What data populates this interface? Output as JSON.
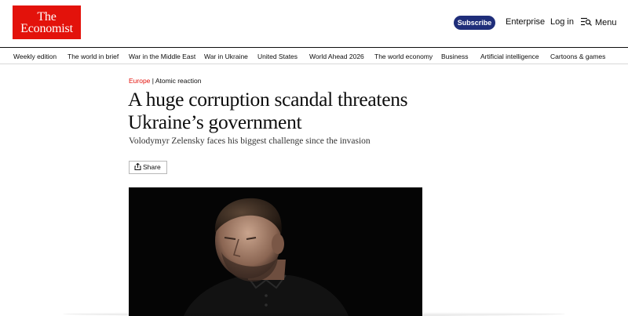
{
  "header": {
    "logo_line1": "The",
    "logo_line2": "Economist",
    "subscribe_label": "Subscribe",
    "enterprise_label": "Enterprise",
    "login_label": "Log in",
    "menu_label": "Menu"
  },
  "nav": {
    "items": [
      "Weekly edition",
      "The world in brief",
      "War in the Middle East",
      "War in Ukraine",
      "United States",
      "World Ahead 2026",
      "The world economy",
      "Business",
      "Artificial intelligence",
      "Cartoons & games"
    ]
  },
  "article": {
    "section": "Europe",
    "separator": " | ",
    "rubric": "Atomic reaction",
    "headline": "A huge corruption scandal threatens Ukraine’s government",
    "standfirst": "Volodymyr Zelensky faces his biggest challenge since the invasion",
    "share_label": "Share"
  },
  "colors": {
    "brand_red": "#e3120b",
    "subscribe_blue": "#1f2e7a",
    "hero_bg": "#050505"
  }
}
